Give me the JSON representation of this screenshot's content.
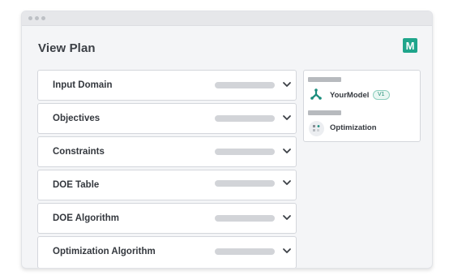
{
  "page": {
    "title": "View Plan"
  },
  "logo": {
    "letter": "M",
    "color": "#1fa58b"
  },
  "panels": [
    {
      "label": "Input Domain"
    },
    {
      "label": "Objectives"
    },
    {
      "label": "Constraints"
    },
    {
      "label": "DOE Table"
    },
    {
      "label": "DOE Algorithm"
    },
    {
      "label": "Optimization Algorithm"
    }
  ],
  "side_card": {
    "model": {
      "name": "YourModel",
      "version": "V1",
      "icon": "model-graph-icon"
    },
    "optimization": {
      "name": "Optimization",
      "icon": "optimization-icon"
    }
  }
}
